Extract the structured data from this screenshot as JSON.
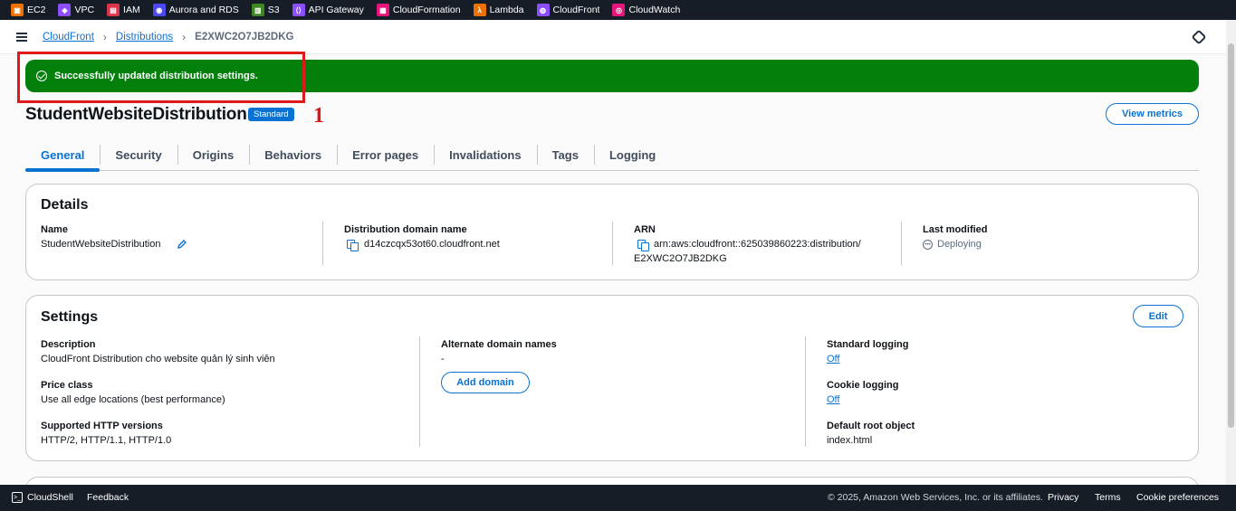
{
  "favorites": [
    {
      "label": "EC2",
      "icon": "ec2-icon",
      "color": "#ed7100"
    },
    {
      "label": "VPC",
      "icon": "vpc-icon",
      "color": "#8c4fff"
    },
    {
      "label": "IAM",
      "icon": "iam-icon",
      "color": "#dd344c"
    },
    {
      "label": "Aurora and RDS",
      "icon": "rds-icon",
      "color": "#4d48f5"
    },
    {
      "label": "S3",
      "icon": "s3-icon",
      "color": "#3f8624"
    },
    {
      "label": "API Gateway",
      "icon": "api-gateway-icon",
      "color": "#8c4fff"
    },
    {
      "label": "CloudFormation",
      "icon": "cloudformation-icon",
      "color": "#e7157b"
    },
    {
      "label": "Lambda",
      "icon": "lambda-icon",
      "color": "#ed7100"
    },
    {
      "label": "CloudFront",
      "icon": "cloudfront-icon",
      "color": "#8c4fff"
    },
    {
      "label": "CloudWatch",
      "icon": "cloudwatch-icon",
      "color": "#e7157b"
    }
  ],
  "breadcrumb": {
    "item1": "CloudFront",
    "item2": "Distributions",
    "current": "E2XWC2O7JB2DKG"
  },
  "flash": {
    "message": "Successfully updated distribution settings.",
    "color": "#037f0c"
  },
  "annotation": {
    "number": "1",
    "color": "#e0191b"
  },
  "page": {
    "title": "StudentWebsiteDistribution",
    "badge": "Standard",
    "view_metrics": "View metrics"
  },
  "tabs": [
    "General",
    "Security",
    "Origins",
    "Behaviors",
    "Error pages",
    "Invalidations",
    "Tags",
    "Logging"
  ],
  "details": {
    "heading": "Details",
    "name_label": "Name",
    "name_value": "StudentWebsiteDistribution",
    "domain_label": "Distribution domain name",
    "domain_value": "d14czcqx53ot60.cloudfront.net",
    "arn_label": "ARN",
    "arn_line1": "arn:aws:cloudfront::625039860223:distribution/",
    "arn_line2": "E2XWC2O7JB2DKG",
    "modified_label": "Last modified",
    "modified_value": "Deploying"
  },
  "settings": {
    "heading": "Settings",
    "edit": "Edit",
    "description_label": "Description",
    "description_value": "CloudFront Distribution cho website quản lý sinh viên",
    "price_label": "Price class",
    "price_value": "Use all edge locations (best performance)",
    "http_label": "Supported HTTP versions",
    "http_value": "HTTP/2, HTTP/1.1, HTTP/1.0",
    "alt_label": "Alternate domain names",
    "alt_value": "-",
    "add_domain": "Add domain",
    "std_logging_label": "Standard logging",
    "std_logging_value": "Off",
    "cookie_logging_label": "Cookie logging",
    "cookie_logging_value": "Off",
    "root_label": "Default root object",
    "root_value": "index.html"
  },
  "footer": {
    "cloudshell": "CloudShell",
    "feedback": "Feedback",
    "copyright": "© 2025, Amazon Web Services, Inc. or its affiliates.",
    "privacy": "Privacy",
    "terms": "Terms",
    "cookies": "Cookie preferences"
  }
}
